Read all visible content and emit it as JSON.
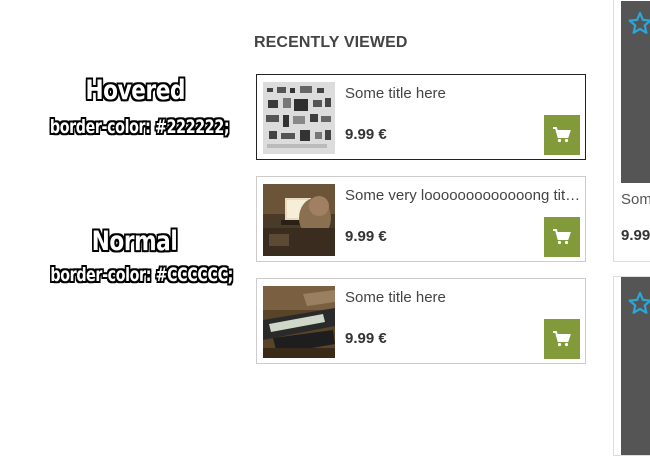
{
  "annotations": {
    "hovered": {
      "heading": "Hovered",
      "css": "border-color: #222222;"
    },
    "normal": {
      "heading": "Normal",
      "css": "border-color: #CCCCCC;"
    }
  },
  "recently_viewed": {
    "title": "RECENTLY VIEWED",
    "items": [
      {
        "title": "Some title here",
        "price": "9.99 €",
        "state": "hovered",
        "thumbnail": "gadgets-flatlay"
      },
      {
        "title": "Some very looooooooooooong title here",
        "price": "9.99 €",
        "state": "normal",
        "thumbnail": "person-at-laptop"
      },
      {
        "title": "Some title here",
        "price": "9.99 €",
        "state": "normal",
        "thumbnail": "phone-on-desk"
      }
    ],
    "add_to_cart_icon": "shopping-cart-icon"
  },
  "product_cards": [
    {
      "title": "Som",
      "price": "9.99",
      "favorite_icon": "star-outline-icon"
    },
    {
      "favorite_icon": "star-outline-icon"
    }
  ],
  "colors": {
    "hovered_border": "#222222",
    "normal_border": "#CCCCCC",
    "cart_button": "#829A3A",
    "star_outline": "#2BA6D6"
  }
}
